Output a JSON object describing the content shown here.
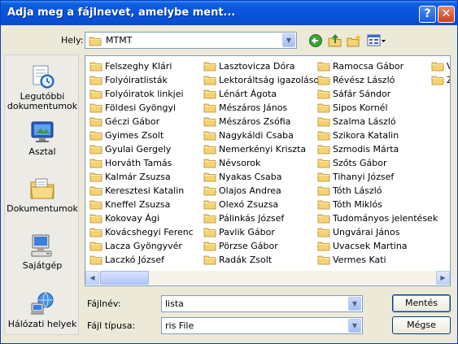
{
  "window": {
    "title": "Adja meg a fájlnevet, amelybe ment...",
    "help_label": "?",
    "close_label": "✕"
  },
  "lookin": {
    "label": "Hely:",
    "value": "MTMT"
  },
  "toolbar_icons": [
    "back-icon",
    "up-folder-icon",
    "new-folder-icon",
    "views-menu-icon"
  ],
  "places": [
    {
      "label": "Legutóbbi dokumentumok",
      "icon": "recent-documents-icon"
    },
    {
      "label": "Asztal",
      "icon": "desktop-icon"
    },
    {
      "label": "Dokumentumok",
      "icon": "documents-icon"
    },
    {
      "label": "Sajátgép",
      "icon": "my-computer-icon"
    },
    {
      "label": "Hálózati helyek",
      "icon": "network-places-icon"
    }
  ],
  "files": {
    "col1": [
      "Felszeghy Klári",
      "Folyóiratlisták",
      "Folyóiratok linkjei",
      "Földesi Gyöngyi",
      "Géczi Gábor",
      "Gyimes Zsolt",
      "Gyulai Gergely",
      "Horváth Tamás",
      "Kalmár Zsuzsa",
      "Keresztesi Katalin",
      "Kneffel Zsuzsa",
      "Kokovay Ági",
      "Kovácshegyi Ferenc",
      "Lacza Gyöngyvér",
      "Laczkó József"
    ],
    "col2": [
      "Lasztovicza Dóra",
      "Lektoráltság igazolások",
      "Lénárt Ágota",
      "Mészáros János",
      "Mészáros Zsófia",
      "Nagykáldi Csaba",
      "Nemerkényi Kriszta",
      "Névsorok",
      "Nyakas Csaba",
      "Olajos Andrea",
      "Olexó Zsuzsa",
      "Pálinkás József",
      "Pavlik Gábor",
      "Pörzse Gábor",
      "Radák Zsolt"
    ],
    "col3": [
      "Ramocsa Gábor",
      "Révész László",
      "Sáfár Sándor",
      "Sipos Kornél",
      "Szalma László",
      "Szikora Katalin",
      "Szmodis Márta",
      "Szőts Gábor",
      "Tihanyi József",
      "Tóth László",
      "Tóth Miklós",
      "Tudományos jelentések",
      "Ungvárai János",
      "Uvacsek Martina",
      "Vermes Kati"
    ],
    "col4": [
      "V",
      "Z"
    ]
  },
  "filename": {
    "label": "Fájlnév:",
    "value": "lista"
  },
  "filetype": {
    "label": "Fájl típusa:",
    "value": "ris File"
  },
  "buttons": {
    "save": "Mentés",
    "cancel": "Mégse"
  },
  "colors": {
    "titlebar": "#0a55db",
    "dialog_bg": "#ece9d8",
    "folder": "#f5d372"
  }
}
